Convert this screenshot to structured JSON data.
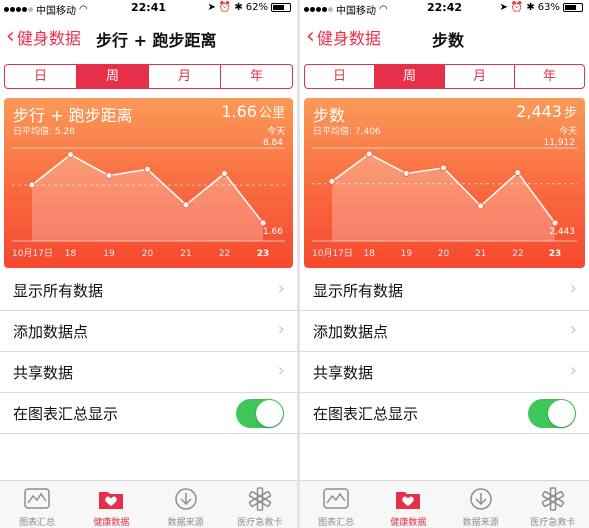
{
  "status": {
    "carrier": "中国移动",
    "screens": [
      {
        "time": "22:41",
        "battery": "62%"
      },
      {
        "time": "22:42",
        "battery": "63%"
      }
    ]
  },
  "back_label": "健身数据",
  "segments": [
    "日",
    "周",
    "月",
    "年"
  ],
  "active_segment": "周",
  "screens": [
    {
      "nav_title": "步行 + 跑步距离",
      "card": {
        "title": "步行 + 跑步距离",
        "avg_label": "日平均值: 5.28",
        "value": "1.66",
        "unit": "公里",
        "day_label": "今天",
        "y_max_label": "8.84",
        "y_min_label": "1.66"
      }
    },
    {
      "nav_title": "步数",
      "card": {
        "title": "步数",
        "avg_label": "日平均值: 7,406",
        "value": "2,443",
        "unit": "步",
        "day_label": "今天",
        "y_max_label": "11,912",
        "y_min_label": "2,443"
      }
    }
  ],
  "chart_data": [
    {
      "type": "line",
      "x": [
        "10月17日",
        "18",
        "19",
        "20",
        "21",
        "22",
        "23"
      ],
      "values": [
        5.3,
        8.2,
        6.2,
        6.8,
        3.4,
        6.4,
        1.66
      ],
      "ylim": [
        1.66,
        8.84
      ],
      "average": 5.28,
      "highlight_label": "23"
    },
    {
      "type": "line",
      "x": [
        "10月17日",
        "18",
        "19",
        "20",
        "21",
        "22",
        "23"
      ],
      "values": [
        7700,
        11150,
        8700,
        9400,
        4600,
        8800,
        2443
      ],
      "ylim": [
        2443,
        11912
      ],
      "average": 7406,
      "highlight_label": "23"
    }
  ],
  "list_items": [
    {
      "label": "显示所有数据",
      "kind": "arrow"
    },
    {
      "label": "添加数据点",
      "kind": "arrow"
    },
    {
      "label": "共享数据",
      "kind": "arrow"
    },
    {
      "label": "在图表汇总显示",
      "kind": "toggle",
      "on": true
    }
  ],
  "tabs": [
    {
      "label": "图表汇总",
      "icon": "chart-icon"
    },
    {
      "label": "健康数据",
      "icon": "heart-folder-icon"
    },
    {
      "label": "数据来源",
      "icon": "download-icon"
    },
    {
      "label": "医疗急救卡",
      "icon": "medical-star-icon"
    }
  ],
  "active_tab": "健康数据",
  "colors": {
    "accent": "#e6304a",
    "card_top": "#fb9a58",
    "card_bottom": "#f5482f",
    "toggle_on": "#3dc75b"
  }
}
